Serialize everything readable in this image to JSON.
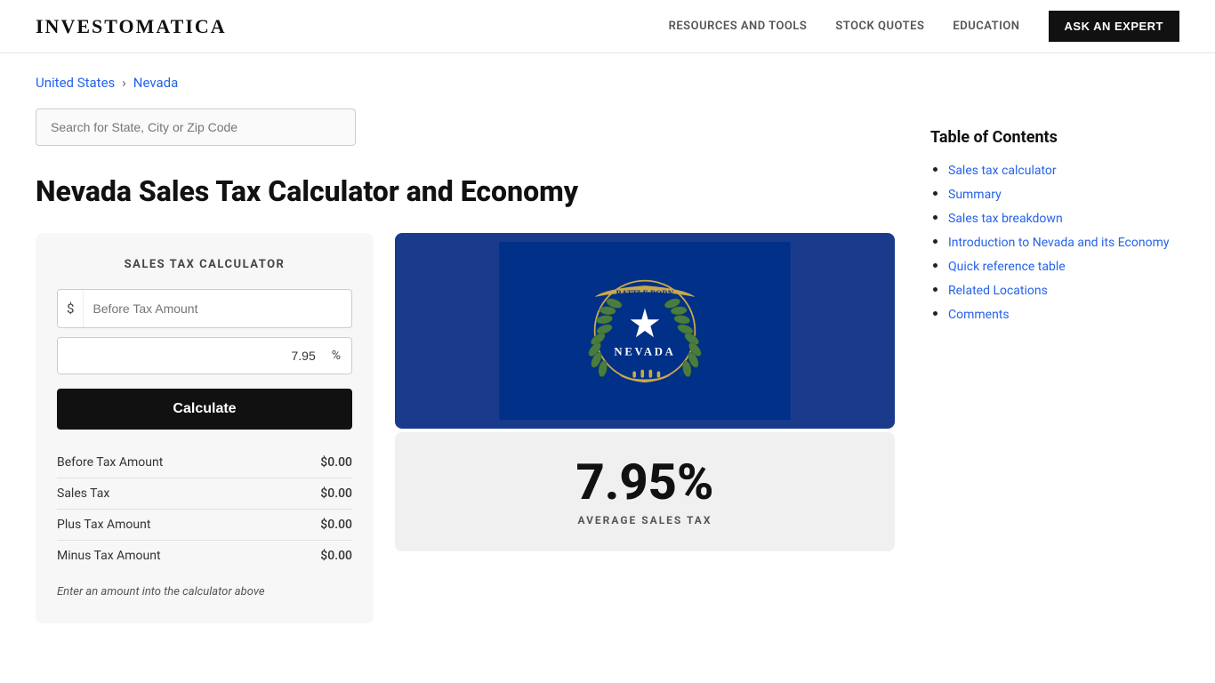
{
  "header": {
    "logo": "INVESTOMATICA",
    "nav": [
      {
        "label": "RESOURCES AND TOOLS",
        "id": "resources-and-tools"
      },
      {
        "label": "STOCK QUOTES",
        "id": "stock-quotes"
      },
      {
        "label": "EDUCATION",
        "id": "education"
      }
    ],
    "ask_expert_label": "ASK AN EXPERT"
  },
  "breadcrumb": {
    "items": [
      {
        "label": "United States",
        "href": "#"
      },
      {
        "label": "Nevada",
        "href": "#"
      }
    ]
  },
  "search": {
    "placeholder": "Search for State, City or Zip Code"
  },
  "page_title": "Nevada Sales Tax Calculator and Economy",
  "calculator": {
    "title": "SALES TAX CALCULATOR",
    "dollar_prefix": "$",
    "amount_placeholder": "Before Tax Amount",
    "tax_rate_value": "7.95",
    "percent_suffix": "%",
    "calculate_label": "Calculate",
    "results": [
      {
        "label": "Before Tax Amount",
        "value": "$0.00"
      },
      {
        "label": "Sales Tax",
        "value": "$0.00"
      },
      {
        "label": "Plus Tax Amount",
        "value": "$0.00"
      },
      {
        "label": "Minus Tax Amount",
        "value": "$0.00"
      }
    ],
    "note": "Enter an amount into the calculator above"
  },
  "percentage_display": {
    "value": "7.95%",
    "label": "AVERAGE SALES TAX"
  },
  "toc": {
    "title": "Table of Contents",
    "items": [
      {
        "label": "Sales tax calculator",
        "href": "#"
      },
      {
        "label": "Summary",
        "href": "#"
      },
      {
        "label": "Sales tax breakdown",
        "href": "#"
      },
      {
        "label": "Introduction to Nevada and its Economy",
        "href": "#"
      },
      {
        "label": "Quick reference table",
        "href": "#"
      },
      {
        "label": "Related Locations",
        "href": "#"
      },
      {
        "label": "Comments",
        "href": "#"
      }
    ]
  }
}
